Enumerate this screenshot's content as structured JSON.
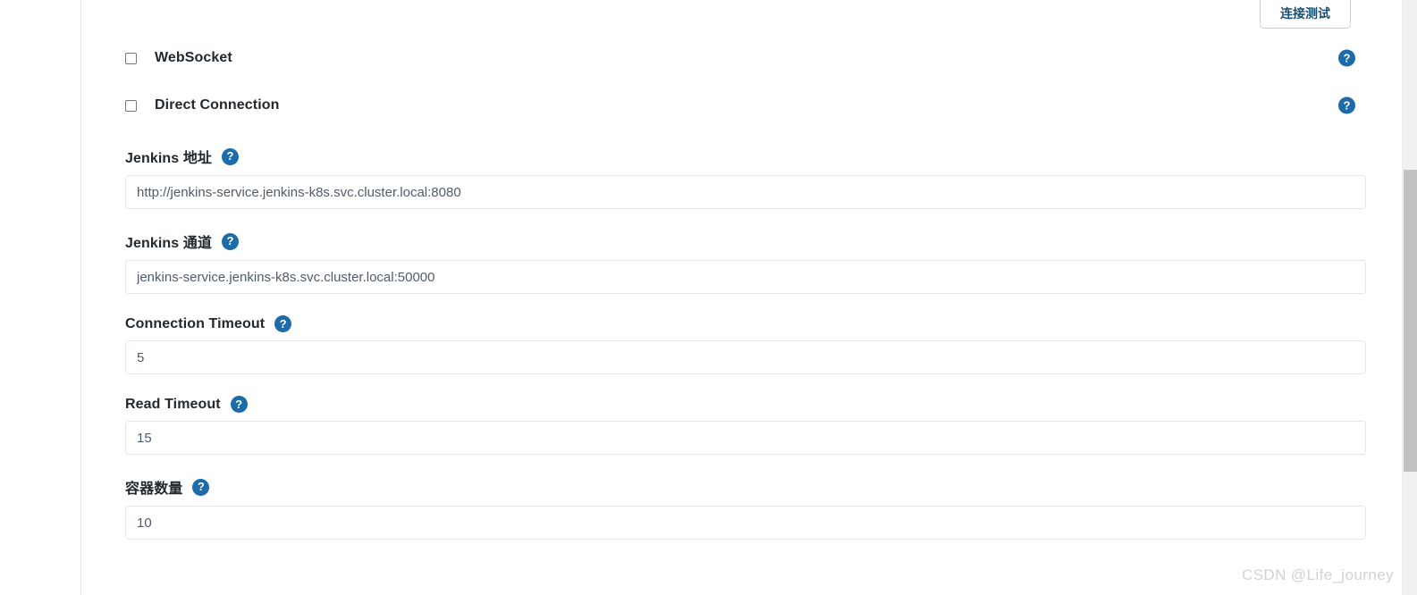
{
  "toolbar": {
    "test_connection_label": "连接测试"
  },
  "icons": {
    "help": "?",
    "help_icon_name": "help-icon",
    "help_color": "#1b6ca8"
  },
  "form": {
    "checkboxes": [
      {
        "label": "WebSocket",
        "checked": false
      },
      {
        "label": "Direct Connection",
        "checked": false
      }
    ],
    "fields": [
      {
        "label": "Jenkins 地址",
        "value": "http://jenkins-service.jenkins-k8s.svc.cluster.local:8080",
        "placeholder": ""
      },
      {
        "label": "Jenkins 通道",
        "value": "jenkins-service.jenkins-k8s.svc.cluster.local:50000",
        "placeholder": ""
      },
      {
        "label": "Connection Timeout",
        "value": "5",
        "placeholder": ""
      },
      {
        "label": "Read Timeout",
        "value": "15",
        "placeholder": ""
      },
      {
        "label": "容器数量",
        "value": "10",
        "placeholder": ""
      }
    ]
  },
  "watermark": {
    "text": "CSDN @Life_journey"
  },
  "colors": {
    "accent": "#1b6ca8",
    "label_text": "#23282c",
    "input_text": "#4f5d6e",
    "input_border": "#e4e7ea",
    "button_text": "#1b4f72",
    "scrollbar_thumb": "#c1c1c1"
  }
}
